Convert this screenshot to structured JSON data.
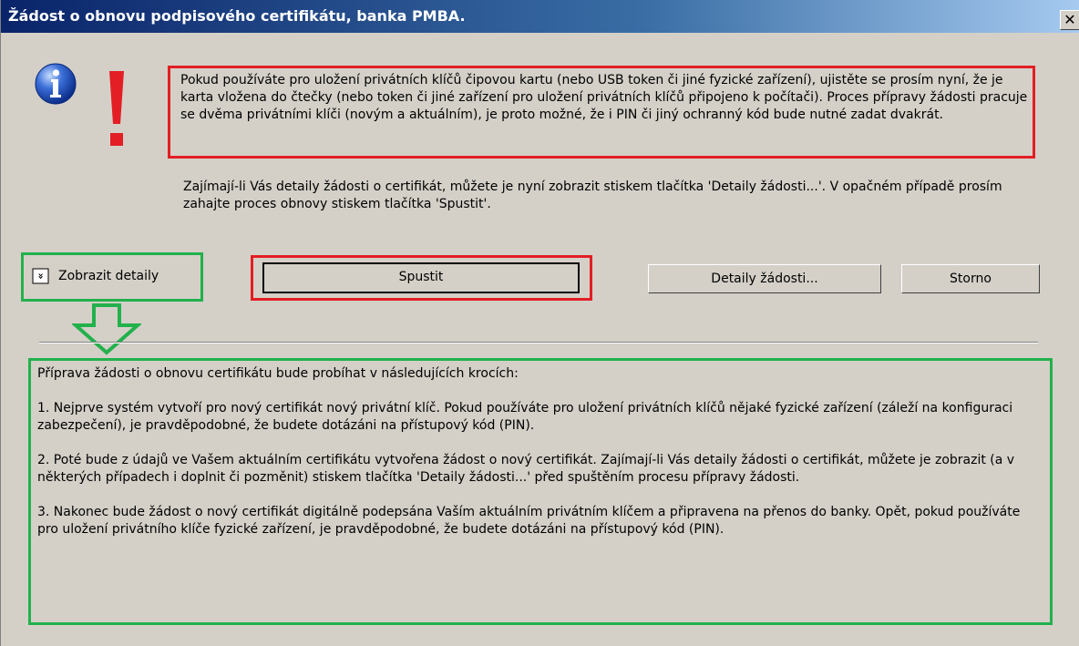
{
  "window": {
    "title": "Žádost o obnovu podpisového certifikátu, banka PMBA.",
    "close_label": "✕"
  },
  "icons": {
    "info": "info-icon",
    "warning": "exclamation-icon",
    "expand": "chevron-down-icon",
    "arrow": "arrow-down-icon"
  },
  "colors": {
    "title_bar": "#0a246a",
    "highlight_red": "#e31e24",
    "highlight_green": "#22b14c",
    "dialog_bg": "#d4d0c8"
  },
  "message": {
    "warning": "Pokud používáte pro uložení privátních klíčů čipovou kartu (nebo USB token či jiné fyzické zařízení), ujistěte se prosím nyní, že je karta vložena do čtečky (nebo token či jiné zařízení pro uložení privátních klíčů připojeno k počítači). Proces přípravy žádosti pracuje se dvěma privátními klíči (novým a aktuálním), je proto možné, že i PIN či jiný ochranný kód bude nutné zadat dvakrát.",
    "description": "Zajímají-li Vás detaily žádosti o certifikát, můžete je nyní zobrazit stiskem tlačítka 'Detaily žádosti...'. V opačném případě prosím zahajte proces obnovy stiskem tlačítka 'Spustit'."
  },
  "toggle": {
    "icon_glyph": "»",
    "label": "Zobrazit detaily"
  },
  "buttons": {
    "start": "Spustit",
    "details": "Detaily žádosti...",
    "cancel": "Storno"
  },
  "details": {
    "intro": "Příprava žádosti o obnovu certifikátu bude probíhat v následujících krocích:",
    "step1": "1. Nejprve systém vytvoří pro nový certifikát nový privátní klíč. Pokud používáte pro uložení privátních klíčů nějaké fyzické zařízení (záleží na konfiguraci zabezpečení), je pravděpodobné, že budete dotázáni na přístupový kód (PIN).",
    "step2": "2. Poté bude z údajů ve Vašem aktuálním certifikátu vytvořena žádost o nový certifikát. Zajímají-li Vás detaily žádosti o certifikát, můžete je zobrazit (a v některých případech i doplnit či pozměnit) stiskem tlačítka 'Detaily žádosti...' před spuštěním procesu přípravy žádosti.",
    "step3": "3. Nakonec bude žádost o nový certifikát digitálně podepsána Vaším aktuálním privátním klíčem a připravena na přenos do banky. Opět, pokud používáte pro uložení privátního klíče fyzické zařízení, je pravděpodobné, že budete dotázáni na přístupový kód (PIN)."
  }
}
